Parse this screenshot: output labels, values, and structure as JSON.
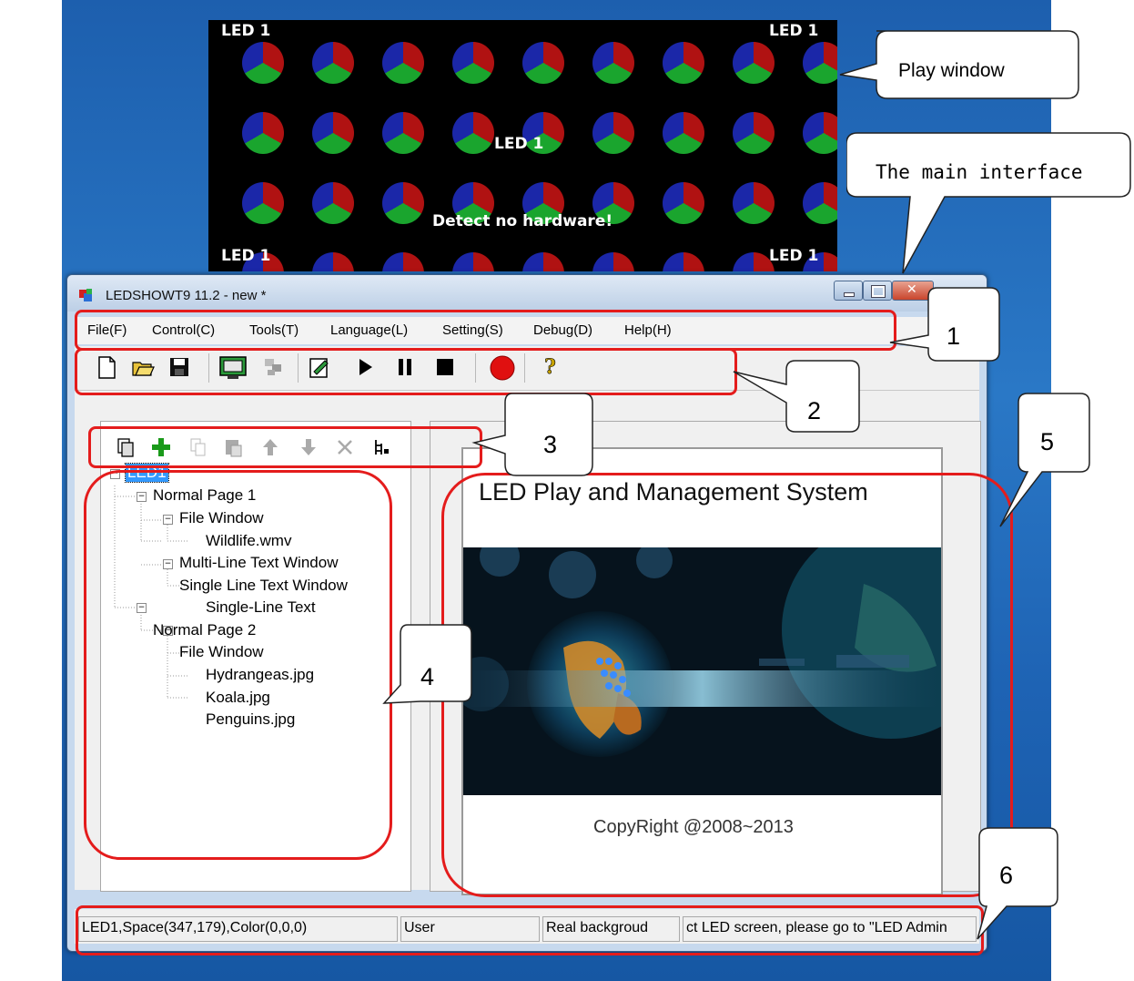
{
  "play_window": {
    "labels": [
      "LED 1",
      "LED 1",
      "LED 1",
      "LED 1",
      "LED 1"
    ],
    "message": "Detect no hardware!"
  },
  "callouts": {
    "play_window": "Play window",
    "main_interface": "The main interface",
    "numbers": [
      "1",
      "2",
      "3",
      "4",
      "5",
      "6"
    ]
  },
  "window": {
    "title": "LEDSHOWT9 11.2 - new *"
  },
  "menu": {
    "items": [
      "File(F)",
      "Control(C)",
      "Tools(T)",
      "Language(L)",
      "Setting(S)",
      "Debug(D)",
      "Help(H)"
    ]
  },
  "toolbar": {
    "icons": [
      "new-file-icon",
      "open-folder-icon",
      "save-icon",
      "screen-icon",
      "network-icon",
      "edit-icon",
      "play-icon",
      "pause-icon",
      "stop-icon",
      "record-icon",
      "help-icon"
    ]
  },
  "tree_toolbar": {
    "icons": [
      "add-page-icon",
      "add-icon",
      "copy-icon",
      "paste-icon",
      "move-up-icon",
      "move-down-icon",
      "delete-icon",
      "expand-tree-icon"
    ]
  },
  "tree": {
    "root": "LED1",
    "nodes": [
      "Normal Page 1",
      "File Window",
      "Wildlife.wmv",
      "Multi-Line Text Window",
      "Single Line Text Window",
      "Single-Line Text",
      "Normal Page 2",
      "File Window",
      "Hydrangeas.jpg",
      "Koala.jpg",
      "Penguins.jpg"
    ]
  },
  "preview": {
    "title": "LED Play and Management System",
    "copyright": "CopyRight  @2008~2013"
  },
  "statusbar": {
    "cell1": "LED1,Space(347,179),Color(0,0,0)",
    "cell2": "User",
    "cell3": "Real backgroud",
    "cell4": "ct LED screen, please go to \"LED Admin"
  },
  "colors": {
    "annotation_red": "#e41c1c",
    "selection_blue": "#3399ff",
    "record_red": "#e01010",
    "add_green": "#1a9a1a"
  }
}
